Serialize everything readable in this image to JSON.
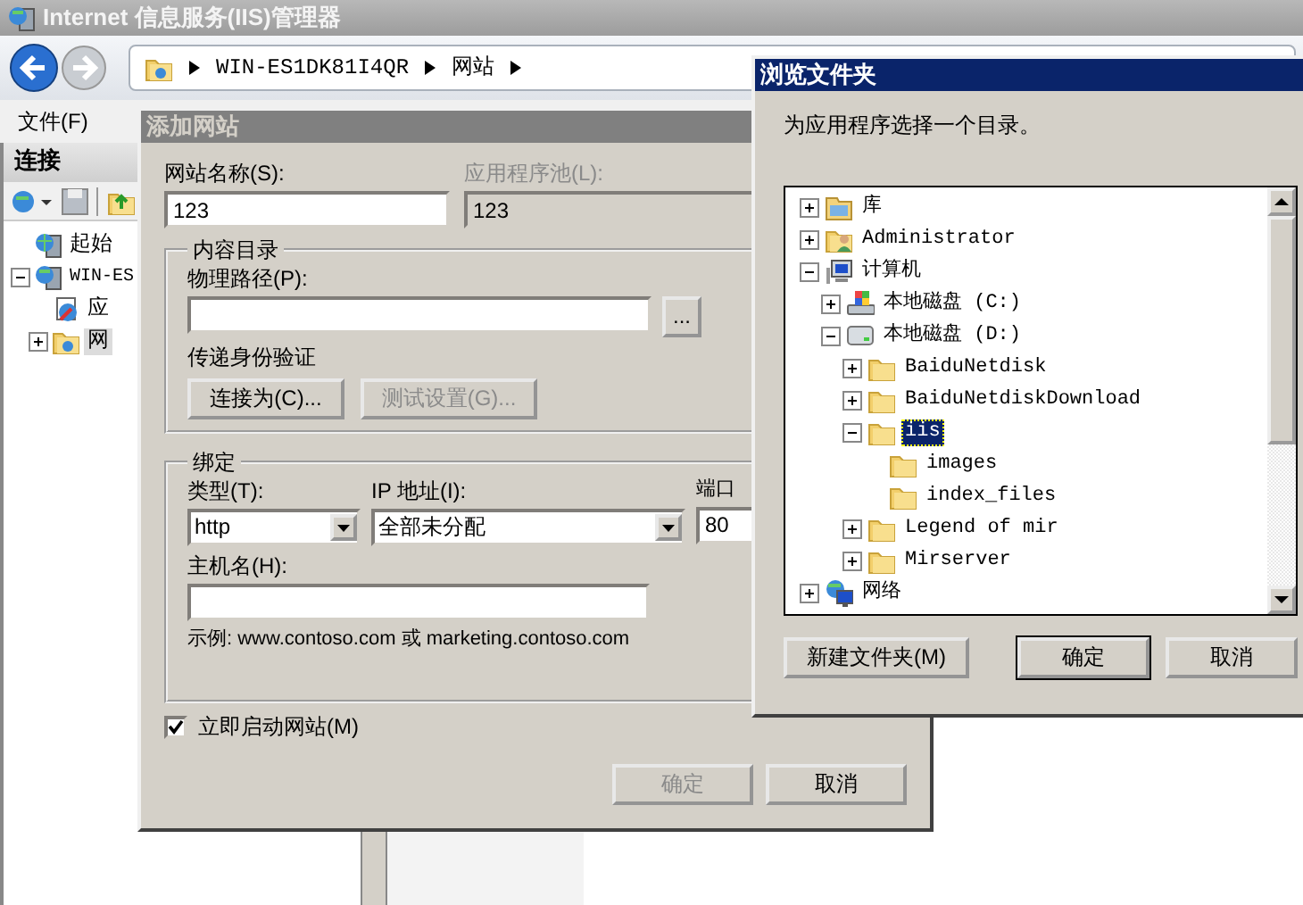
{
  "main_window": {
    "title": "Internet 信息服务(IIS)管理器",
    "breadcrumb": [
      "WIN-ES1DK81I4QR",
      "网站"
    ],
    "menu": [
      "文件(F)"
    ],
    "connections": {
      "title": "连接",
      "tree": [
        {
          "label": "起始",
          "kind": "start",
          "selected": false
        },
        {
          "label": "WIN-ES",
          "kind": "server",
          "selected": false,
          "expanded": true,
          "children": [
            {
              "label": "应",
              "kind": "pools",
              "selected": false
            },
            {
              "label": "网",
              "kind": "sites",
              "selected": true,
              "expanded": false
            }
          ]
        }
      ]
    }
  },
  "add_site_dialog": {
    "title": "添加网站",
    "site_name": {
      "label": "网站名称(S):",
      "value": "123"
    },
    "app_pool": {
      "label": "应用程序池(L):",
      "value": "123",
      "disabled": true
    },
    "content_directory": {
      "title": "内容目录",
      "physical_path": {
        "label": "物理路径(P):"
      },
      "browse_button": "...",
      "auth_label": "传递身份验证",
      "buttons": [
        {
          "label": "连接为(C)...",
          "disabled": false
        },
        {
          "label": "测试设置(G)...",
          "disabled": true
        }
      ]
    },
    "binding": {
      "title": "绑定",
      "type": {
        "label": "类型(T):",
        "value": "http"
      },
      "ip": {
        "label": "IP 地址(I):",
        "value": "全部未分配"
      },
      "port": {
        "label": "端口",
        "value": "80"
      },
      "host": {
        "label": "主机名(H):"
      },
      "example": "示例: www.contoso.com 或 marketing.contoso.com"
    },
    "start_now": {
      "label": "立即启动网站(M)",
      "checked": true
    },
    "buttons": [
      {
        "label": "确定",
        "disabled": true
      },
      {
        "label": "取消",
        "disabled": false
      }
    ]
  },
  "browse_dialog": {
    "title": "浏览文件夹",
    "prompt": "为应用程序选择一个目录。",
    "tree": [
      {
        "label": "库",
        "kind": "library",
        "expanded": false,
        "selected": false
      },
      {
        "label": "Administrator",
        "kind": "user",
        "expanded": false,
        "selected": false
      },
      {
        "label": "计算机",
        "kind": "computer",
        "expanded": true,
        "selected": false,
        "children": [
          {
            "label": "本地磁盘 (C:)",
            "kind": "system-drive",
            "expanded": false,
            "selected": false
          },
          {
            "label": "本地磁盘 (D:)",
            "kind": "drive",
            "expanded": true,
            "selected": false,
            "children": [
              {
                "label": "BaiduNetdisk",
                "kind": "folder",
                "expanded": false,
                "selected": false
              },
              {
                "label": "BaiduNetdiskDownload",
                "kind": "folder",
                "expanded": false,
                "selected": false
              },
              {
                "label": "iis",
                "kind": "folder",
                "expanded": true,
                "selected": true,
                "children": [
                  {
                    "label": "images",
                    "kind": "folder",
                    "selected": false
                  },
                  {
                    "label": "index_files",
                    "kind": "folder",
                    "selected": false
                  }
                ]
              },
              {
                "label": "Legend of mir",
                "kind": "folder",
                "expanded": false,
                "selected": false
              },
              {
                "label": "Mirserver",
                "kind": "folder",
                "expanded": false,
                "selected": false
              }
            ]
          }
        ]
      },
      {
        "label": "网络",
        "kind": "network",
        "expanded": false,
        "selected": false
      }
    ],
    "buttons": [
      {
        "label": "新建文件夹(M)",
        "default": false
      },
      {
        "label": "确定",
        "default": true
      },
      {
        "label": "取消",
        "default": false
      }
    ]
  }
}
